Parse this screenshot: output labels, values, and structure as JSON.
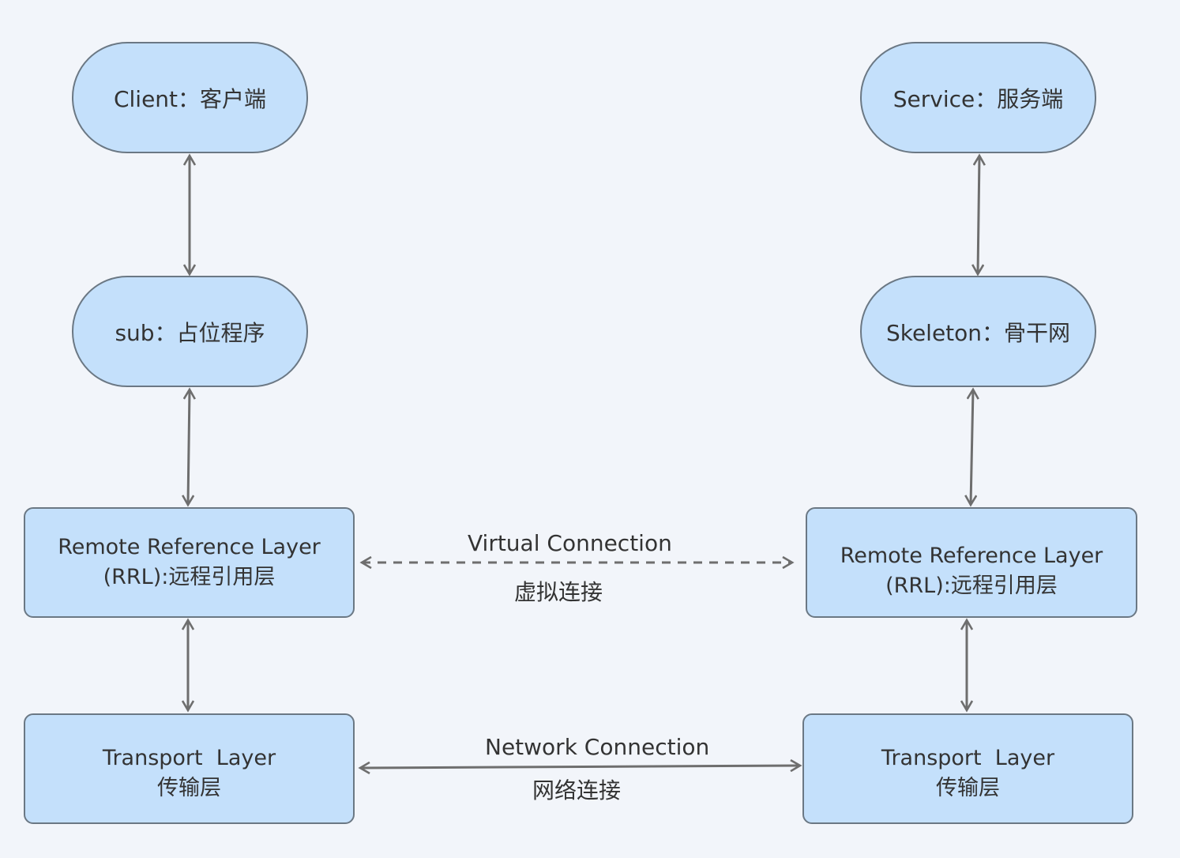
{
  "colors": {
    "node_fill": "#c4e0fb",
    "node_border": "#6b7884",
    "line": "#6e6e6e",
    "background": "#f2f5fa"
  },
  "client": {
    "label": "Client：客户端"
  },
  "stub": {
    "label": "sub：占位程序"
  },
  "client_rrl": {
    "line1": "Remote Reference Layer",
    "line2": "(RRL):远程引用层"
  },
  "client_transport": {
    "line1": "Transport  Layer",
    "line2": "传输层"
  },
  "service": {
    "label": "Service：服务端"
  },
  "skeleton": {
    "label": "Skeleton：骨干网"
  },
  "server_rrl": {
    "line1": "Remote Reference Layer",
    "line2": "(RRL):远程引用层"
  },
  "server_transport": {
    "line1": "Transport  Layer",
    "line2": "传输层"
  },
  "virtual_connection": {
    "en": "Virtual Connection",
    "zh": "虚拟连接"
  },
  "network_connection": {
    "en": "Network Connection",
    "zh": "网络连接"
  }
}
